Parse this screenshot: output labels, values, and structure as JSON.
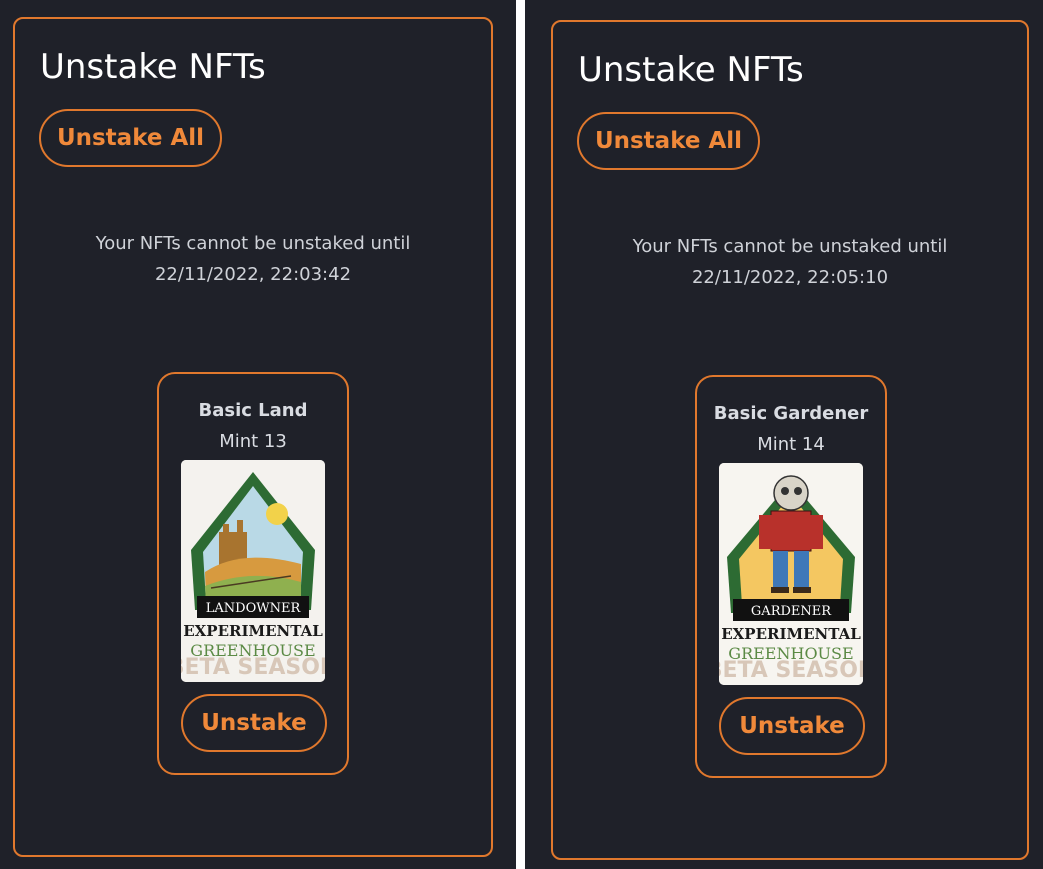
{
  "screens": [
    {
      "title": "Unstake NFTs",
      "unstake_all_label": "Unstake All",
      "notice_line1": "Your NFTs cannot be unstaked until",
      "notice_line2": "22/11/2022, 22:03:42",
      "nft": {
        "name": "Basic Land",
        "mint": "Mint 13",
        "image_banner": "LANDOWNER",
        "image_brand_line1": "EXPERIMENTAL",
        "image_brand_line2": "GREENHOUSE",
        "image_faded_text": "BETA SEASON",
        "unstake_label": "Unstake"
      }
    },
    {
      "title": "Unstake NFTs",
      "unstake_all_label": "Unstake All",
      "notice_line1": "Your NFTs cannot be unstaked until",
      "notice_line2": "22/11/2022, 22:05:10",
      "nft": {
        "name": "Basic Gardener",
        "mint": "Mint 14",
        "image_banner": "GARDENER",
        "image_brand_line1": "EXPERIMENTAL",
        "image_brand_line2": "GREENHOUSE",
        "image_faded_text": "BETA SEASON",
        "unstake_label": "Unstake"
      }
    }
  ],
  "colors": {
    "background": "#1f2129",
    "accent": "#e0782d",
    "accent_text": "#f0893a",
    "title_text": "#ffffff",
    "body_text": "#cfd2d8"
  }
}
